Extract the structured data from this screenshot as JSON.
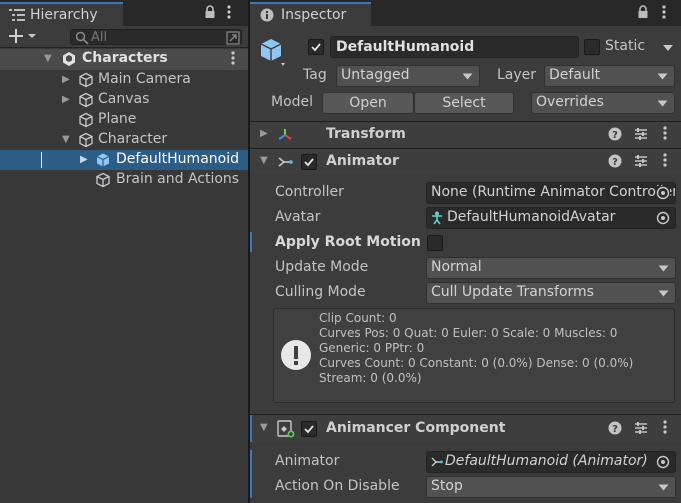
{
  "hierarchy": {
    "tab_label": "Hierarchy",
    "search_placeholder": "All",
    "scene_name": "Characters",
    "items": [
      {
        "label": "Main Camera"
      },
      {
        "label": "Canvas"
      },
      {
        "label": "Plane"
      },
      {
        "label": "Character"
      },
      {
        "label": "DefaultHumanoid"
      },
      {
        "label": "Brain and Actions"
      }
    ]
  },
  "inspector": {
    "tab_label": "Inspector",
    "object_name": "DefaultHumanoid",
    "static_label": "Static",
    "tag_label": "Tag",
    "tag_value": "Untagged",
    "layer_label": "Layer",
    "layer_value": "Default",
    "model_label": "Model",
    "open_label": "Open",
    "select_label": "Select",
    "overrides_label": "Overrides",
    "components": {
      "transform": {
        "title": "Transform"
      },
      "animator": {
        "title": "Animator",
        "fields": [
          {
            "label": "Controller",
            "value": "None (Runtime Animator Controller)"
          },
          {
            "label": "Avatar",
            "value": "DefaultHumanoidAvatar"
          },
          {
            "label": "Apply Root Motion"
          },
          {
            "label": "Update Mode",
            "value": "Normal"
          },
          {
            "label": "Culling Mode",
            "value": "Cull Update Transforms"
          }
        ],
        "info_lines": [
          "Clip Count: 0",
          "Curves Pos: 0 Quat: 0 Euler: 0 Scale: 0 Muscles: 0",
          "Generic: 0 PPtr: 0",
          "Curves Count: 0 Constant: 0 (0.0%) Dense: 0 (0.0%)",
          "Stream: 0 (0.0%)"
        ]
      },
      "animancer": {
        "title": "Animancer Component",
        "fields": [
          {
            "label": "Animator",
            "value": "DefaultHumanoid (Animator)"
          },
          {
            "label": "Action On Disable",
            "value": "Stop"
          }
        ]
      }
    }
  },
  "colors": {
    "selection": "#2c5d87",
    "tab_accent": "#3a79bb",
    "panel_dark": "#282828",
    "panel": "#3c3c3c"
  }
}
